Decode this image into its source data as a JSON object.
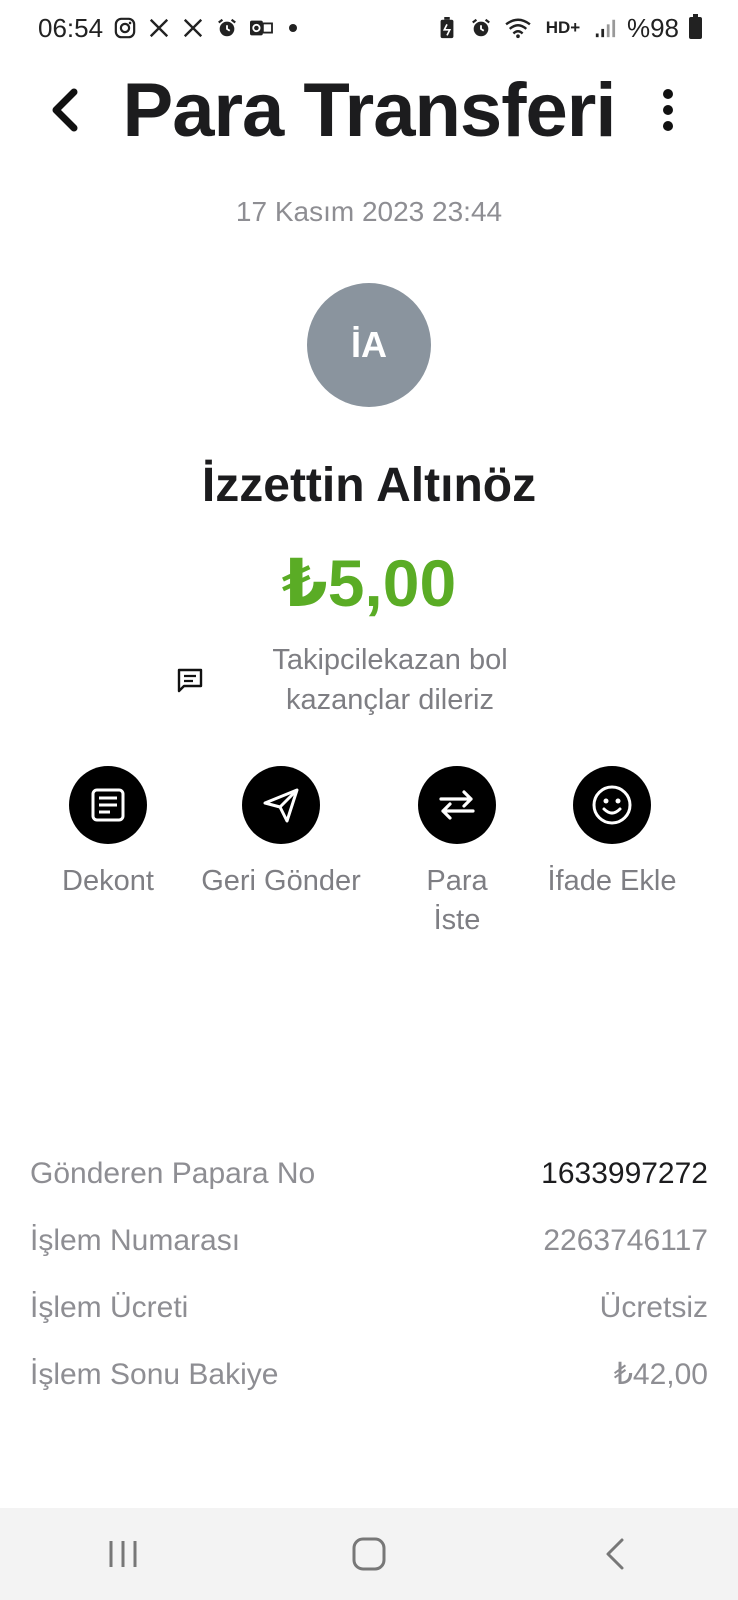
{
  "status_bar": {
    "time": "06:54",
    "battery": "%98",
    "left_icons": [
      "instagram-icon",
      "x-icon",
      "x-icon",
      "alarm-icon",
      "outlook-icon",
      "dot-icon"
    ],
    "right_icons": [
      "battery-saver-icon",
      "alarm-icon",
      "wifi-icon",
      "hd-volte-icon",
      "signal-icon",
      "battery-icon"
    ]
  },
  "header": {
    "title": "Para Transferi",
    "back_icon": "chevron-left-icon",
    "menu_icon": "more-vertical-icon"
  },
  "transfer": {
    "date": "17 Kasım 2023 23:44",
    "avatar_initials": "İA",
    "recipient_name": "İzzettin Altınöz",
    "amount": "₺5,00",
    "amount_color": "#5aac25",
    "message_line1": "Takipcilekazan bol",
    "message_line2": "kazançlar dileriz",
    "message_icon": "message-icon"
  },
  "actions": [
    {
      "label": "Dekont",
      "icon": "receipt-icon"
    },
    {
      "label": "Geri Gönder",
      "icon": "send-icon"
    },
    {
      "label_line1": "Para",
      "label_line2": "İste",
      "icon": "swap-arrows-icon"
    },
    {
      "label": "İfade Ekle",
      "icon": "smiley-icon"
    }
  ],
  "details": [
    {
      "label": "Gönderen Papara No",
      "value": "1633997272"
    },
    {
      "label": "İşlem Numarası",
      "value": "2263746117"
    },
    {
      "label": "İşlem Ücreti",
      "value": "Ücretsiz"
    },
    {
      "label": "İşlem Sonu Bakiye",
      "value": "₺42,00"
    }
  ],
  "nav_bar": {
    "icons": [
      "recent-apps-icon",
      "home-icon",
      "back-icon"
    ]
  }
}
